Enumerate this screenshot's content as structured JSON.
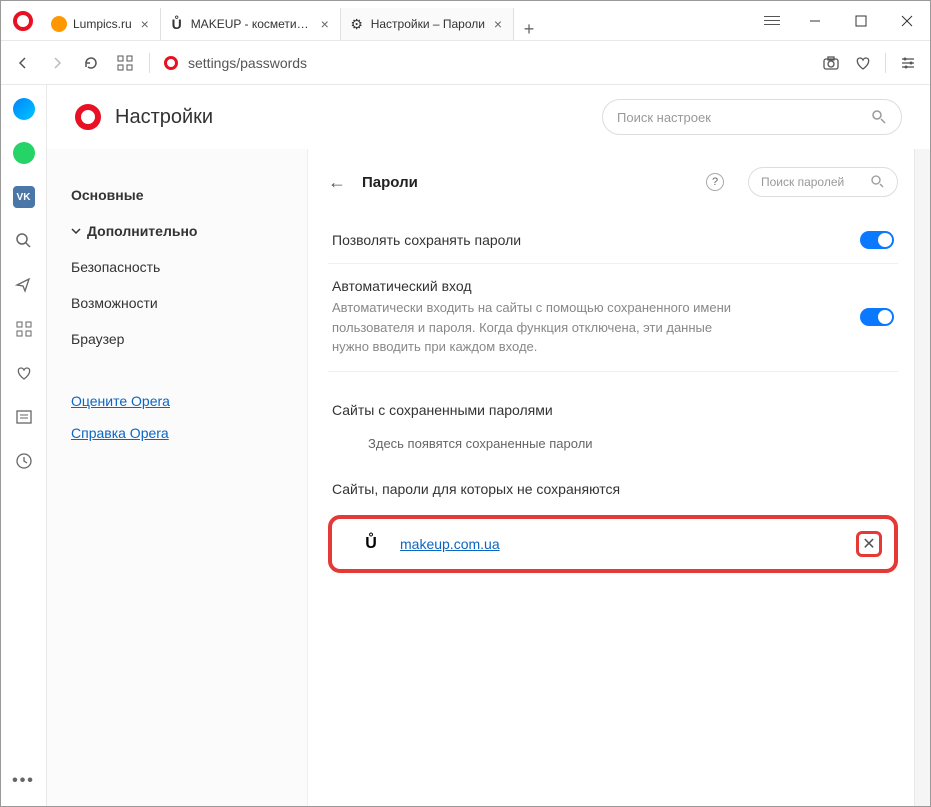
{
  "tabs": [
    {
      "title": "Lumpics.ru",
      "icon": "orange"
    },
    {
      "title": "MAKEUP - косметика и па",
      "icon": "U"
    },
    {
      "title": "Настройки – Пароли",
      "icon": "gear",
      "active": true
    }
  ],
  "url": "settings/passwords",
  "header": {
    "title": "Настройки",
    "search_placeholder": "Поиск настроек"
  },
  "nav": {
    "main": "Основные",
    "advanced": "Дополнительно",
    "security": "Безопасность",
    "features": "Возможности",
    "browser": "Браузер",
    "rate": "Оцените Opera",
    "help": "Справка Opera"
  },
  "passwords": {
    "title": "Пароли",
    "search": "Поиск паролей",
    "allow_save": "Позволять сохранять пароли",
    "auto_login_title": "Автоматический вход",
    "auto_login_desc": "Автоматически входить на сайты с помощью сохраненного имени пользователя и пароля. Когда функция отключена, эти данные нужно вводить при каждом входе.",
    "saved_title": "Сайты с сохраненными паролями",
    "saved_empty": "Здесь появятся сохраненные пароли",
    "never_title": "Сайты, пароли для которых не сохраняются",
    "never_site": "makeup.com.ua"
  }
}
